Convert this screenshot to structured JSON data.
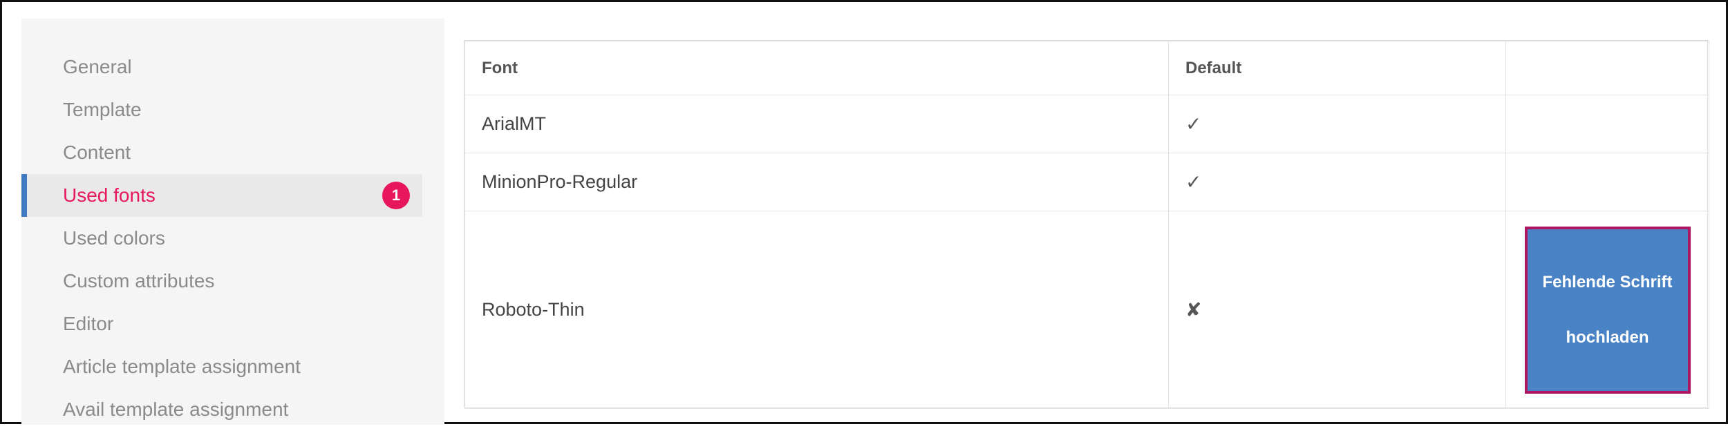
{
  "sidebar": {
    "items": [
      {
        "label": "General"
      },
      {
        "label": "Template"
      },
      {
        "label": "Content"
      },
      {
        "label": "Used fonts",
        "badge": "1"
      },
      {
        "label": "Used colors"
      },
      {
        "label": "Custom attributes"
      },
      {
        "label": "Editor"
      },
      {
        "label": "Article template assignment"
      },
      {
        "label": "Avail template assignment"
      }
    ],
    "active_index": 3
  },
  "table": {
    "headers": [
      "Font",
      "Default",
      ""
    ],
    "rows": [
      {
        "font": "ArialMT",
        "default": "✓"
      },
      {
        "font": "MinionPro-Regular",
        "default": "✓"
      },
      {
        "font": "Roboto-Thin",
        "default": "✘",
        "action": "Fehlende Schrift hochladen"
      }
    ]
  },
  "colors": {
    "accent_pink": "#e8175d",
    "accent_blue": "#3e7bc4",
    "button_border": "#b01561"
  }
}
